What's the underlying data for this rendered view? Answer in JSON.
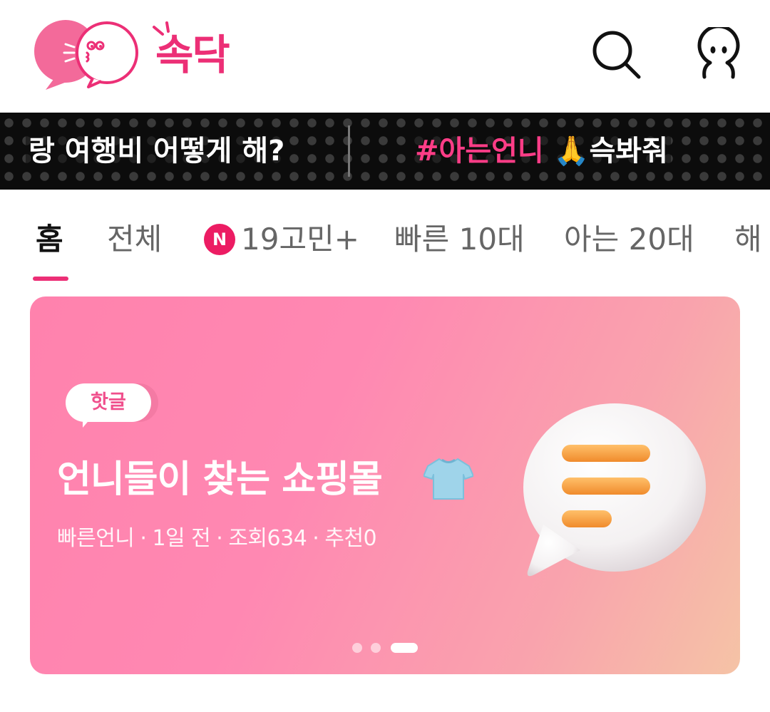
{
  "header": {
    "logo_text": "속닥",
    "search_icon": "search-icon",
    "profile_icon": "profile-icon"
  },
  "ticker": {
    "item1": "랑 여행비 어떻게 해?",
    "item2_tag": "#아는언니",
    "item2_emoji": "🙏",
    "item2_text": "슥봐줘"
  },
  "tabs": {
    "items": [
      {
        "label": "홈",
        "active": true
      },
      {
        "label": "전체"
      },
      {
        "label": "19고민+",
        "badge": "N"
      },
      {
        "label": "빠른 10대"
      },
      {
        "label": "아는 20대"
      },
      {
        "label": "해"
      }
    ]
  },
  "banner": {
    "badge": "핫글",
    "title": "언니들이 찾는 쇼핑몰",
    "title_emoji": "shirt-icon",
    "meta": {
      "author": "빠른언니",
      "time": "1일 전",
      "views": "조회634",
      "likes": "추천0"
    },
    "pager": {
      "total": 3,
      "current": 3
    },
    "colors": {
      "gradient_start": "#ff82ad",
      "gradient_end": "#f5c3a6",
      "badge_text": "#f04f8c"
    }
  },
  "colors": {
    "brand": "#ec2f76",
    "ticker_bg": "#0c0c0c",
    "ticker_tag": "#ff3d87"
  }
}
